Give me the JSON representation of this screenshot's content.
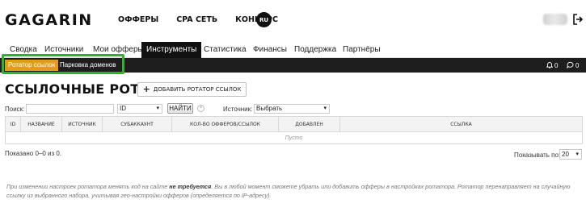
{
  "header": {
    "logo": "GAGARIN",
    "nav": [
      "ОФФЕРЫ",
      "CPA СЕТЬ",
      "КОНКУРС"
    ],
    "lang": "RU"
  },
  "tabs": [
    {
      "label": "Сводка",
      "active": false
    },
    {
      "label": "Источники",
      "active": false
    },
    {
      "label": "Мои офферы",
      "active": false
    },
    {
      "label": "Инструменты",
      "active": true
    },
    {
      "label": "Статистика",
      "active": false
    },
    {
      "label": "Финансы",
      "active": false
    },
    {
      "label": "Поддержка",
      "active": false
    },
    {
      "label": "Партнёры",
      "active": false
    }
  ],
  "subnav": {
    "items": [
      "Ротатор ссылок",
      "Парковка доменов"
    ],
    "notifications_count": "0",
    "messages_count": "0"
  },
  "page": {
    "title": "ССЫЛОЧНЫЕ РОТАТОРЫ",
    "add_button": "ДОБАВИТЬ РОТАТОР ССЫЛОК"
  },
  "filters": {
    "search_label": "Поиск:",
    "search_value": "",
    "field_select": "ID",
    "find_button": "НАЙТИ",
    "source_label": "Источник:",
    "source_select": "Выбрать"
  },
  "table": {
    "columns": [
      "ID",
      "НАЗВАНИЕ",
      "ИСТОЧНИК",
      "СУБАККАУНТ",
      "КОЛ-ВО ОФФЕРОВ/ССЫЛОК",
      "ДОБАВЛЕН",
      "ССЫЛКА"
    ],
    "empty_text": "Пусто"
  },
  "pagination": {
    "shown_text": "Показано 0–0 из 0.",
    "per_page_label": "Показывать по:",
    "per_page_value": "20"
  },
  "note": {
    "part1": "При изменении настроек ротатора менять код на сайте ",
    "bold": "не требуется",
    "part2": ". Вы в любой момент сможете убрать или добавить офферы в настройках ротатора. Ротатор перенаправляет на случайную ссылку из выбранного набора, учитывая гео-настройки офферов (определяется по IP-адресу)."
  },
  "colors": {
    "subbar_bg": "#1e1e1e",
    "active_sub": "#e49b1a",
    "highlight": "#2db52a"
  }
}
